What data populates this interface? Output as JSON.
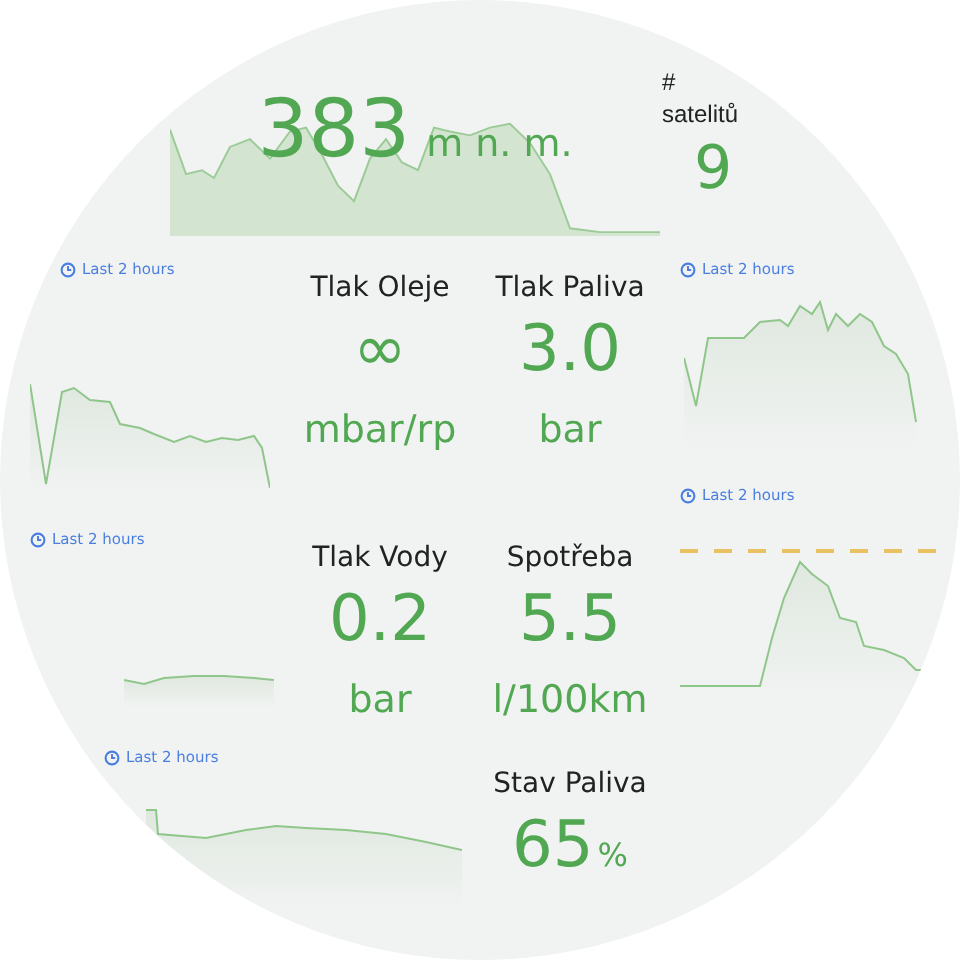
{
  "altitude": {
    "value": "383",
    "unit": "m n. m."
  },
  "satellites": {
    "label": "# satelitů",
    "value": "9"
  },
  "stats": [
    {
      "kind": "stacked",
      "label": "Tlak Oleje",
      "value": "∞",
      "unit": "mbar/rp"
    },
    {
      "kind": "stacked",
      "label": "Tlak Paliva",
      "value": "3.0",
      "unit": "bar"
    },
    {
      "kind": "stacked",
      "label": "Tlak Vody",
      "value": "0.2",
      "unit": "bar"
    },
    {
      "kind": "stacked",
      "label": "Spotřeba",
      "value": "5.5",
      "unit": "l/100km"
    },
    {
      "kind": "inline",
      "label": "Stav Paliva",
      "value": "65",
      "unit": "%"
    }
  ],
  "panels": [
    {
      "time_range": "Last 2 hours"
    },
    {
      "time_range": "Last 2 hours"
    },
    {
      "time_range": "Last 2 hours"
    },
    {
      "time_range": "Last 2 hours"
    },
    {
      "time_range": "Last 2 hours"
    }
  ]
}
